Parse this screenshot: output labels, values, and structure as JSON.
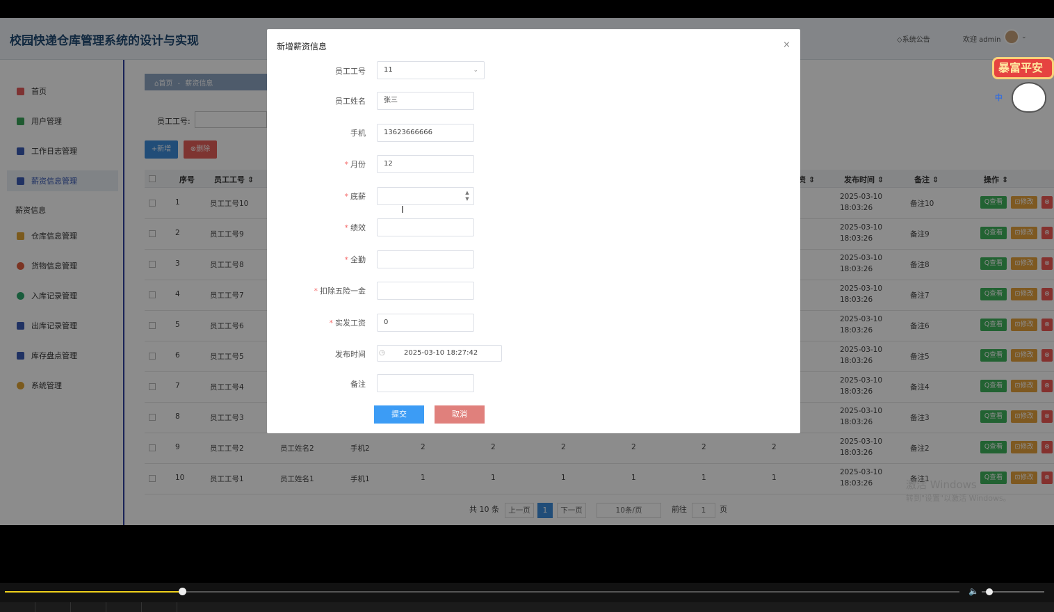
{
  "header": {
    "title": "校园快递仓库管理系统的设计与实现",
    "notice": "◇系统公告",
    "welcome": "欢迎 admin"
  },
  "sidebar": {
    "items": [
      {
        "label": "首页",
        "color": "#e55b5b"
      },
      {
        "label": "用户管理",
        "color": "#3aa45a"
      },
      {
        "label": "工作日志管理",
        "color": "#3b5bb5"
      },
      {
        "label": "薪资信息管理",
        "color": "#3b5bb5"
      }
    ],
    "group": "薪资信息",
    "items2": [
      {
        "label": "仓库信息管理",
        "color": "#e0a436"
      },
      {
        "label": "货物信息管理",
        "color": "#e06040"
      },
      {
        "label": "入库记录管理",
        "color": "#2ea86e"
      },
      {
        "label": "出库记录管理",
        "color": "#3b5bb5"
      },
      {
        "label": "库存盘点管理",
        "color": "#3b5bb5"
      },
      {
        "label": "系统管理",
        "color": "#e0a436"
      }
    ]
  },
  "breadcrumb": {
    "home": "⌂首页",
    "sep": "-",
    "current": "薪资信息"
  },
  "filter": {
    "label": "员工工号:"
  },
  "toolbar": {
    "add": "+新增",
    "delete": "⊗删除"
  },
  "table": {
    "headers": {
      "seq": "序号",
      "emp_no": "员工工号 ⇕",
      "col_partial": "资 ⇕",
      "publish_time": "发布时间 ⇕",
      "remark": "备注 ⇕",
      "ops": "操作 ⇕"
    },
    "rows": [
      {
        "seq": "1",
        "emp_no": "员工工号10",
        "name": "",
        "phone": "",
        "v": [
          "",
          "",
          "",
          "",
          "",
          ""
        ],
        "time": "2025-03-10 18:03:26",
        "remark": "备注10"
      },
      {
        "seq": "2",
        "emp_no": "员工工号9",
        "name": "",
        "phone": "",
        "v": [
          "",
          "",
          "",
          "",
          "",
          ""
        ],
        "time": "2025-03-10 18:03:26",
        "remark": "备注9"
      },
      {
        "seq": "3",
        "emp_no": "员工工号8",
        "name": "",
        "phone": "",
        "v": [
          "",
          "",
          "",
          "",
          "",
          ""
        ],
        "time": "2025-03-10 18:03:26",
        "remark": "备注8"
      },
      {
        "seq": "4",
        "emp_no": "员工工号7",
        "name": "",
        "phone": "",
        "v": [
          "",
          "",
          "",
          "",
          "",
          ""
        ],
        "time": "2025-03-10 18:03:26",
        "remark": "备注7"
      },
      {
        "seq": "5",
        "emp_no": "员工工号6",
        "name": "",
        "phone": "",
        "v": [
          "",
          "",
          "",
          "",
          "",
          ""
        ],
        "time": "2025-03-10 18:03:26",
        "remark": "备注6"
      },
      {
        "seq": "6",
        "emp_no": "员工工号5",
        "name": "",
        "phone": "",
        "v": [
          "",
          "",
          "",
          "",
          "",
          ""
        ],
        "time": "2025-03-10 18:03:26",
        "remark": "备注5"
      },
      {
        "seq": "7",
        "emp_no": "员工工号4",
        "name": "",
        "phone": "",
        "v": [
          "",
          "",
          "",
          "",
          "",
          ""
        ],
        "time": "2025-03-10 18:03:26",
        "remark": "备注4"
      },
      {
        "seq": "8",
        "emp_no": "员工工号3",
        "name": "",
        "phone": "",
        "v": [
          "",
          "",
          "",
          "",
          "",
          ""
        ],
        "time": "2025-03-10 18:03:26",
        "remark": "备注3"
      },
      {
        "seq": "9",
        "emp_no": "员工工号2",
        "name": "员工姓名2",
        "phone": "手机2",
        "v": [
          "2",
          "2",
          "2",
          "2",
          "2",
          "2"
        ],
        "time": "2025-03-10 18:03:26",
        "remark": "备注2"
      },
      {
        "seq": "10",
        "emp_no": "员工工号1",
        "name": "员工姓名1",
        "phone": "手机1",
        "v": [
          "1",
          "1",
          "1",
          "1",
          "1",
          "1"
        ],
        "time": "2025-03-10 18:03:26",
        "remark": "备注1"
      }
    ],
    "actions": {
      "view": "Q查看",
      "edit": "⊡修改",
      "delete": "⊗"
    }
  },
  "pagination": {
    "total": "共 10 条",
    "prev": "上一页",
    "current": "1",
    "next": "下一页",
    "page_size": "10条/页",
    "goto_label": "前往",
    "goto_value": "1",
    "page_unit": "页"
  },
  "watermark": {
    "line1": "激活 Windows",
    "line2": "转到\"设置\"以激活 Windows。"
  },
  "dialog": {
    "title": "新增薪资信息",
    "close": "×",
    "fields": {
      "emp_no": {
        "label": "员工工号",
        "value": "11"
      },
      "emp_name": {
        "label": "员工姓名",
        "value": "张三"
      },
      "phone": {
        "label": "手机",
        "value": "13623666666"
      },
      "month": {
        "label": "月份",
        "value": "12"
      },
      "base": {
        "label": "底薪",
        "value": ""
      },
      "perf": {
        "label": "绩效",
        "value": ""
      },
      "attend": {
        "label": "全勤",
        "value": ""
      },
      "deduct": {
        "label": "扣除五险一金",
        "value": ""
      },
      "actual": {
        "label": "实发工资",
        "value": "0"
      },
      "publish": {
        "label": "发布时间",
        "value": "2025-03-10 18:27:42"
      },
      "remark": {
        "label": "备注",
        "value": ""
      }
    },
    "required_mark": "*",
    "submit": "提交",
    "cancel": "取消"
  },
  "sticker": {
    "text": "暴富平安",
    "mid": "中"
  },
  "player": {
    "progress": 0.19,
    "volume": 0.1
  }
}
